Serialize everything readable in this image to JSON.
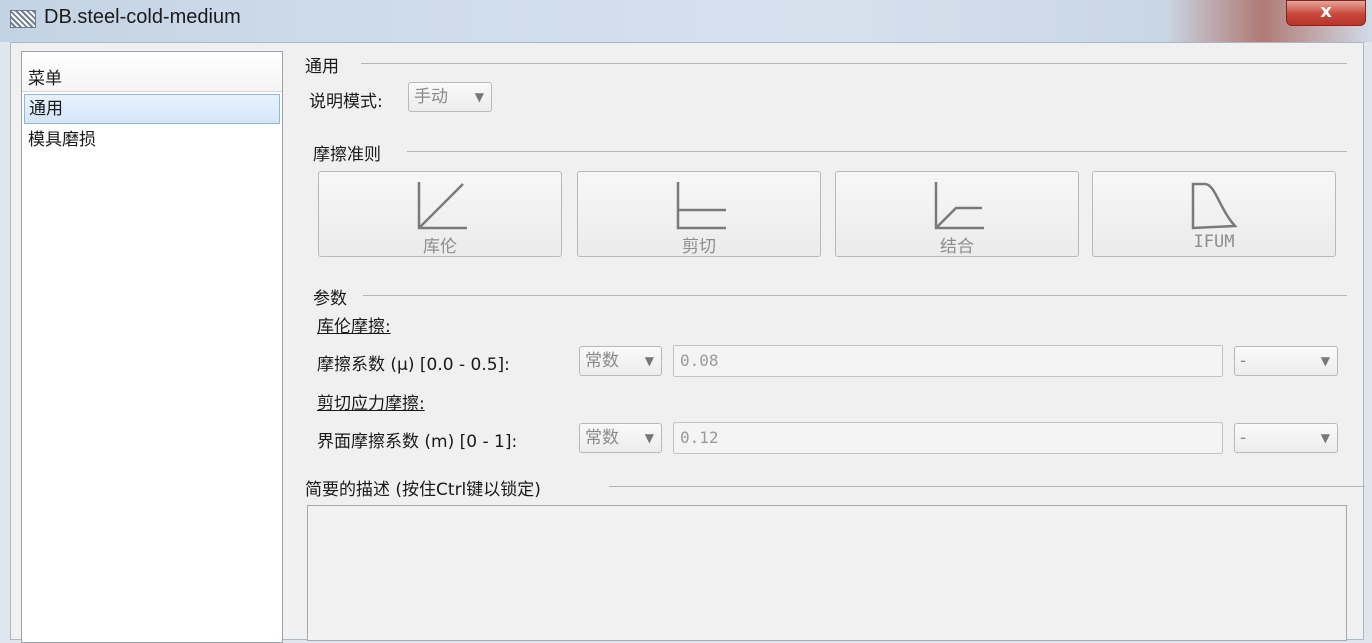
{
  "window": {
    "title": "DB.steel-cold-medium",
    "close_label": "x"
  },
  "menu": {
    "header": "菜单",
    "items": [
      {
        "label": "通用",
        "selected": true
      },
      {
        "label": "模具磨损",
        "selected": false
      }
    ]
  },
  "general": {
    "group_title": "通用",
    "mode_label": "说明模式:",
    "mode_value": "手动"
  },
  "friction_criteria": {
    "group_title": "摩擦准则",
    "buttons": [
      {
        "label": "库伦",
        "icon": "coulomb-icon"
      },
      {
        "label": "剪切",
        "icon": "shear-icon"
      },
      {
        "label": "结合",
        "icon": "combined-icon"
      },
      {
        "label": "IFUM",
        "icon": "ifum-icon"
      }
    ]
  },
  "parameters": {
    "group_title": "参数",
    "coulomb": {
      "section_label": "库伦摩擦:",
      "label": "摩擦系数 (μ) [0.0 - 0.5]:",
      "type_value": "常数",
      "value": "0.08",
      "unit_value": "-"
    },
    "shear": {
      "section_label": "剪切应力摩擦:",
      "label": "界面摩擦系数 (m) [0 - 1]:",
      "type_value": "常数",
      "value": "0.12",
      "unit_value": "-"
    }
  },
  "description": {
    "group_title": "简要的描述 (按住Ctrl键以锁定)",
    "text": ""
  }
}
